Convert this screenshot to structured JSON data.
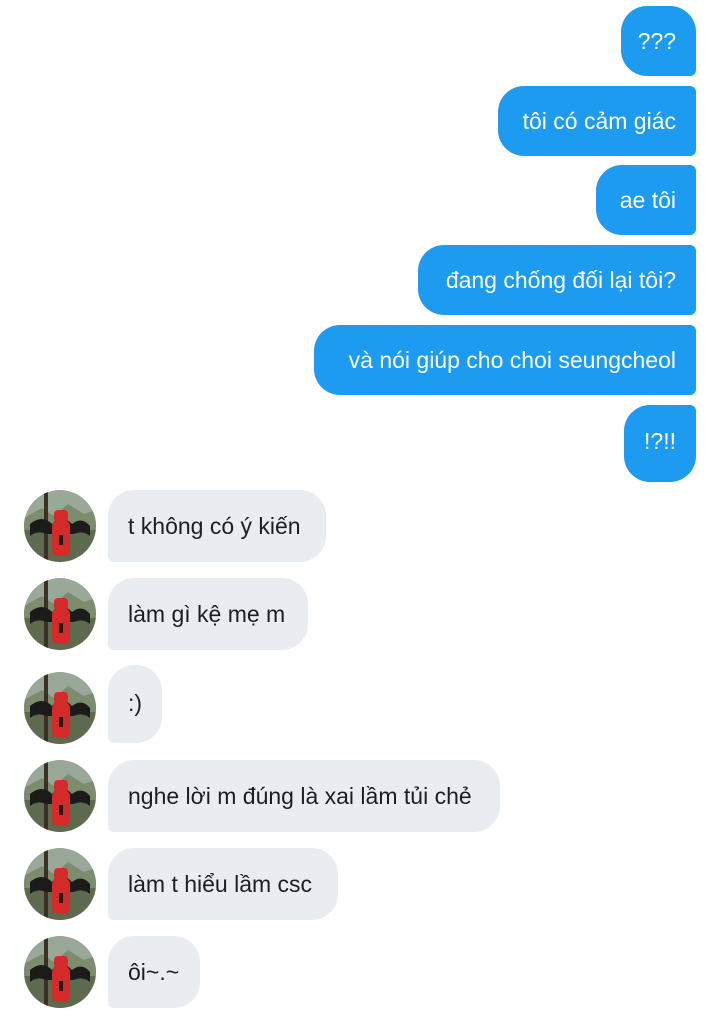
{
  "theme": {
    "sent_color": "#1d9bf0",
    "received_color": "#e9edf1"
  },
  "messages": {
    "sent": [
      "???",
      "tôi có cảm giác",
      "ae tôi",
      "đang chống đối lại tôi?",
      "và nói giúp cho choi seungcheol",
      "!?!!"
    ],
    "received": [
      "t không có ý kiến",
      "làm gì kệ mẹ m",
      ":)",
      "nghe lời m đúng là xai lầm tủi chẻ",
      "làm t hiểu lầm csc",
      "ôi~.~"
    ]
  },
  "avatar": {
    "icon": "user-avatar-photo"
  }
}
